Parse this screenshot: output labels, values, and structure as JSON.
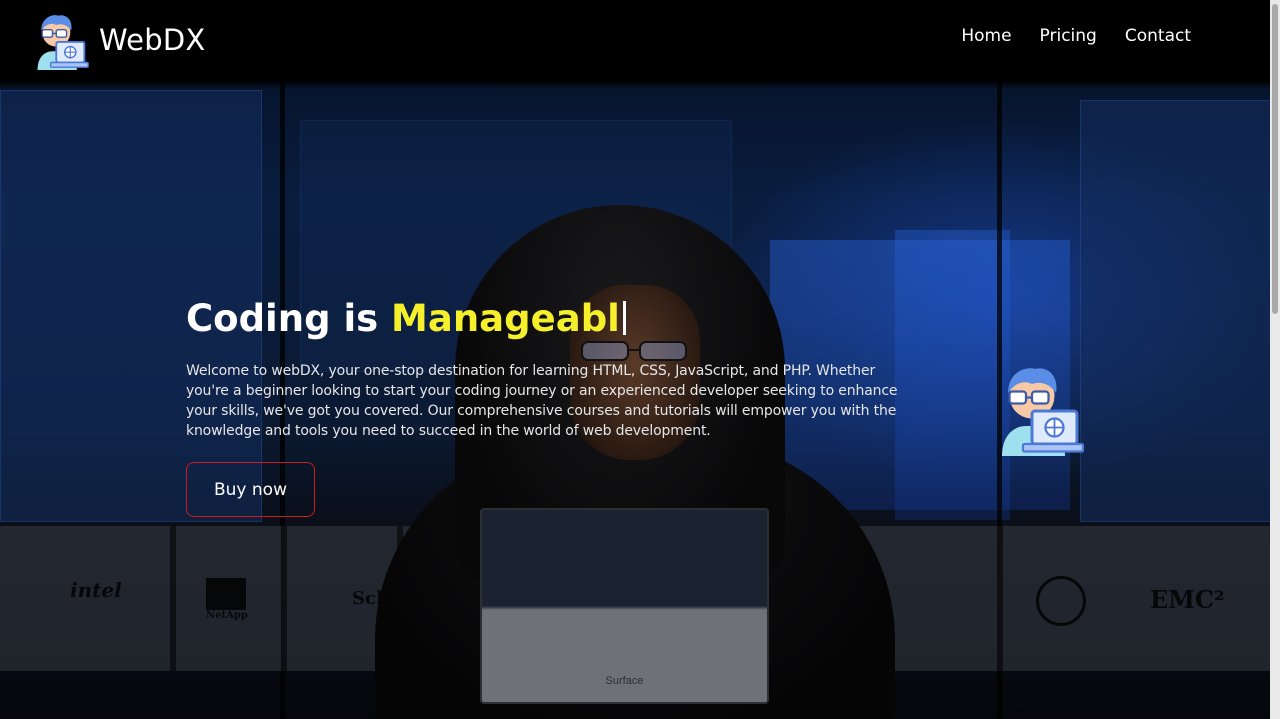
{
  "brand": {
    "name": "WebDX",
    "icon": "developer-avatar-icon"
  },
  "nav": {
    "items": [
      {
        "label": "Home"
      },
      {
        "label": "Pricing"
      },
      {
        "label": "Contact"
      }
    ]
  },
  "hero": {
    "title_prefix": "Coding is",
    "title_typed": "Manageabl",
    "description": "Welcome to webDX, your one-stop destination for learning HTML, CSS, JavaScript, and PHP. Whether you're a beginner looking to start your coding journey or an experienced developer seeking to enhance your skills, we've got you covered. Our comprehensive courses and tutorials will empower you with the knowledge and tools you need to succeed in the world of web development.",
    "cta_label": "Buy now",
    "illustration_icon": "developer-avatar-icon"
  },
  "background": {
    "logos": [
      "intel",
      "NetApp",
      "Sch",
      "EMC²"
    ],
    "laptop_mark": "Surface"
  },
  "colors": {
    "accent": "#f6ef2b",
    "button_border": "#c81e1e",
    "nav_text": "#ffffff"
  }
}
